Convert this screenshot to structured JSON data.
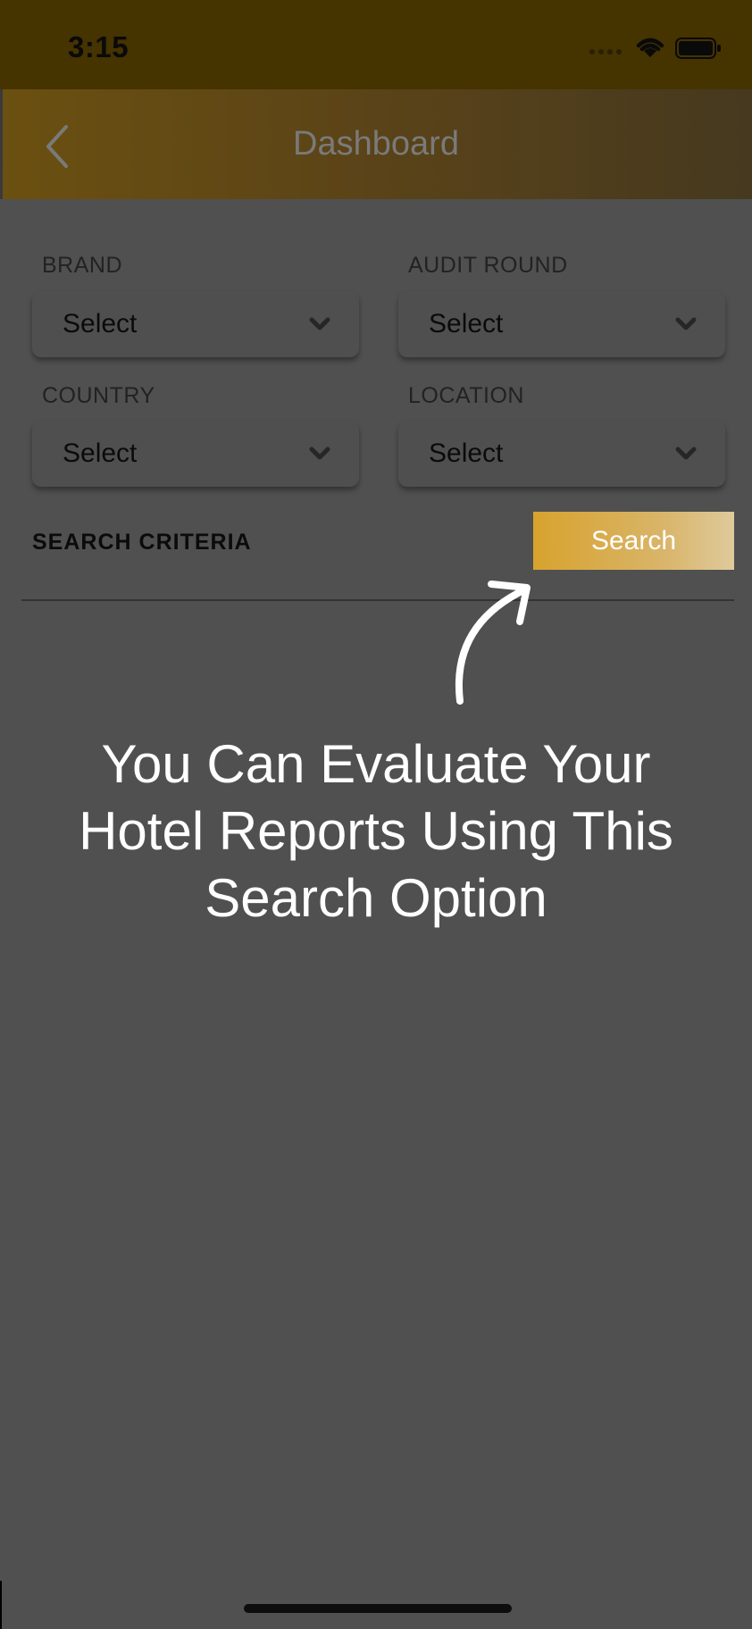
{
  "status_bar": {
    "time": "3:15"
  },
  "nav": {
    "title": "Dashboard"
  },
  "filters": {
    "brand": {
      "label": "BRAND",
      "value": "Select"
    },
    "audit_round": {
      "label": "AUDIT ROUND",
      "value": "Select"
    },
    "country": {
      "label": "COUNTRY",
      "value": "Select"
    },
    "location": {
      "label": "LOCATION",
      "value": "Select"
    }
  },
  "search": {
    "criteria_label": "SEARCH CRITERIA",
    "button_label": "Search"
  },
  "overlay": {
    "tip_line_1": "You Can Evaluate Your",
    "tip_line_2": "Hotel Reports Using This",
    "tip_line_3": "Search Option"
  },
  "colors": {
    "status_bar": "#453300",
    "nav_bar": "#5a4318",
    "overlay_background": "#505050",
    "search_button": "#d7a32e",
    "tip_text": "#ffffff"
  },
  "icons": {
    "back": "chevron-left-icon",
    "dropdown": "chevron-down-icon",
    "pointer": "curved-arrow-icon",
    "wifi": "wifi-icon",
    "battery": "battery-icon",
    "signal": "signal-icon"
  }
}
